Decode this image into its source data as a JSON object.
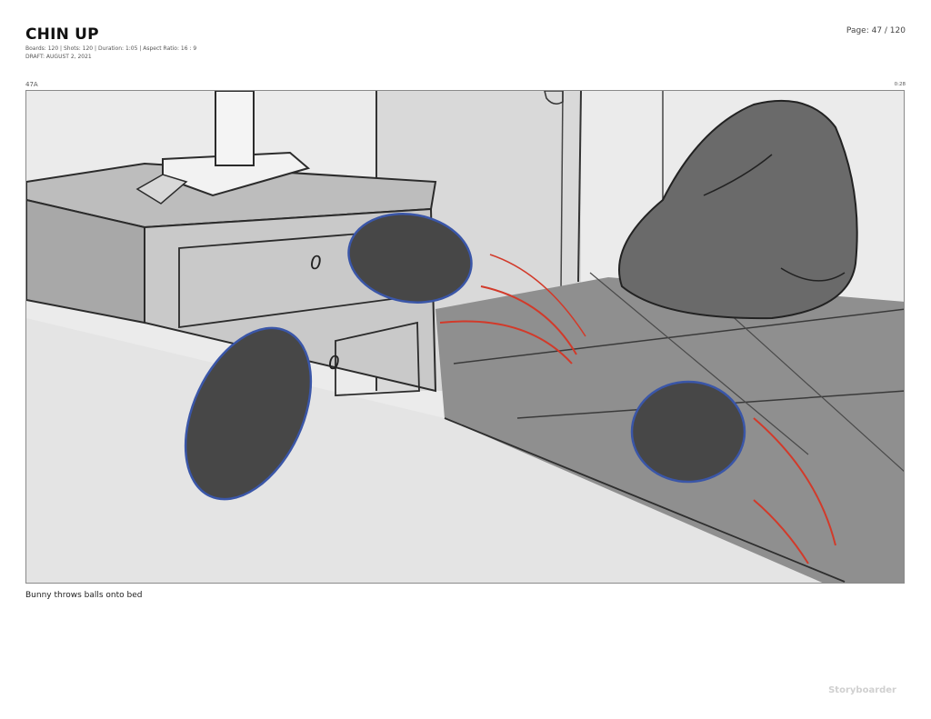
{
  "header": {
    "title": "CHIN UP",
    "meta_line1": "Boards: 120 | Shots: 120 | Duration: 1:05 | Aspect Ratio: 16 : 9",
    "meta_line2": "DRAFT: AUGUST 2, 2021",
    "page": "Page: 47 / 120"
  },
  "board": {
    "shot_label": "47A",
    "time": "0:28",
    "caption": "Bunny throws balls onto bed"
  },
  "drawing": {
    "drawer_mark_upper": "0",
    "drawer_mark_lower": "0",
    "ball_fill": "#474747",
    "ball_outline": "#3a56a8",
    "motion_lines": "#d23a2a"
  },
  "footer": {
    "brand": "Storyboarder"
  }
}
